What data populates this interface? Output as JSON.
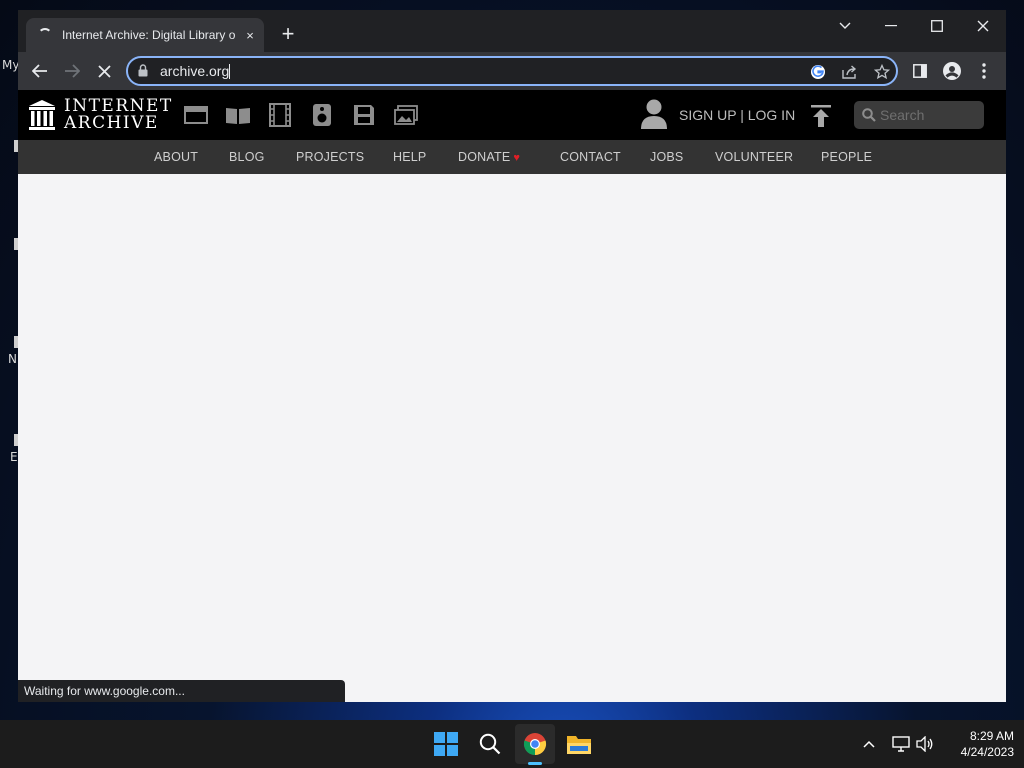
{
  "desktop": {
    "fragments": [
      "My",
      "N",
      "E"
    ]
  },
  "browser": {
    "tab": {
      "title": "Internet Archive: Digital Library o",
      "close": "×"
    },
    "new_tab": "+",
    "address": {
      "url": "archive.org"
    },
    "icons": [
      "back-icon",
      "forward-icon",
      "stop-loading-icon",
      "lock-icon",
      "google-lens-icon",
      "share-icon",
      "bookmark-star-icon",
      "side-panel-icon",
      "profile-icon",
      "menu-icon"
    ],
    "status": "Waiting for www.google.com..."
  },
  "site": {
    "logo": {
      "line1": "INTERNET",
      "line2": "ARCHIVE"
    },
    "media_icons": [
      "web-icon",
      "texts-icon",
      "video-icon",
      "audio-icon",
      "software-icon",
      "images-icon"
    ],
    "account_link": "SIGN UP | LOG IN",
    "search_placeholder": "Search",
    "nav": [
      {
        "label": "ABOUT"
      },
      {
        "label": "BLOG"
      },
      {
        "label": "PROJECTS"
      },
      {
        "label": "HELP"
      },
      {
        "label": "DONATE"
      },
      {
        "label": "CONTACT"
      },
      {
        "label": "JOBS"
      },
      {
        "label": "VOLUNTEER"
      },
      {
        "label": "PEOPLE"
      }
    ],
    "colors": {
      "topbar": "#000000",
      "navbar": "#333333",
      "donate_heart": "#e01f26",
      "focus_ring": "#8ab4f8"
    }
  },
  "taskbar": {
    "apps": [
      "start-icon",
      "search-icon",
      "chrome-icon",
      "file-explorer-icon"
    ],
    "tray_icons": [
      "chevron-up-icon",
      "network-icon",
      "volume-icon"
    ],
    "time": "8:29 AM",
    "date": "4/24/2023"
  }
}
